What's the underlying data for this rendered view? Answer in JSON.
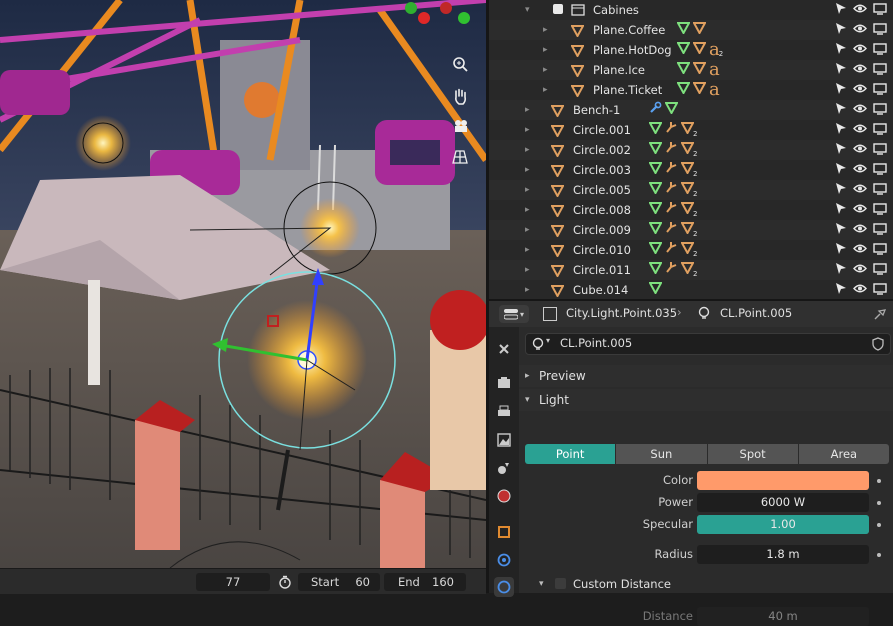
{
  "outliner": {
    "rows": [
      {
        "name": "Cabines",
        "indent": 2,
        "type": "collection",
        "checked": true,
        "mods": []
      },
      {
        "name": "Plane.Coffee",
        "indent": 3,
        "type": "mesh",
        "mods": [
          "mesh",
          "mat"
        ]
      },
      {
        "name": "Plane.HotDog",
        "indent": 3,
        "type": "mesh",
        "mods": [
          "mesh",
          "mat",
          "text2"
        ]
      },
      {
        "name": "Plane.Ice",
        "indent": 3,
        "type": "mesh",
        "mods": [
          "mesh",
          "mat",
          "text"
        ]
      },
      {
        "name": "Plane.Ticket",
        "indent": 3,
        "type": "mesh",
        "mods": [
          "mesh",
          "mat",
          "text"
        ]
      },
      {
        "name": "Bench-1",
        "indent": 2,
        "type": "mesh",
        "mods": [
          "wrench",
          "mesh"
        ]
      },
      {
        "name": "Circle.001",
        "indent": 2,
        "type": "mesh",
        "mods": [
          "mesh",
          "vgroup",
          "mat2"
        ]
      },
      {
        "name": "Circle.002",
        "indent": 2,
        "type": "mesh",
        "mods": [
          "mesh",
          "vgroup",
          "mat2"
        ]
      },
      {
        "name": "Circle.003",
        "indent": 2,
        "type": "mesh",
        "mods": [
          "mesh",
          "vgroup",
          "mat2"
        ]
      },
      {
        "name": "Circle.005",
        "indent": 2,
        "type": "mesh",
        "mods": [
          "mesh",
          "vgroup",
          "mat2"
        ]
      },
      {
        "name": "Circle.008",
        "indent": 2,
        "type": "mesh",
        "mods": [
          "mesh",
          "vgroup",
          "mat2"
        ]
      },
      {
        "name": "Circle.009",
        "indent": 2,
        "type": "mesh",
        "mods": [
          "mesh",
          "vgroup",
          "mat2"
        ]
      },
      {
        "name": "Circle.010",
        "indent": 2,
        "type": "mesh",
        "mods": [
          "mesh",
          "vgroup",
          "mat2"
        ]
      },
      {
        "name": "Circle.011",
        "indent": 2,
        "type": "mesh",
        "mods": [
          "mesh",
          "vgroup",
          "mat2"
        ]
      },
      {
        "name": "Cube.014",
        "indent": 2,
        "type": "mesh",
        "mods": [
          "mesh"
        ]
      }
    ],
    "badge_count": "2",
    "text_glyph": "a"
  },
  "props": {
    "breadcrumb_object": "City.Light.Point.035",
    "breadcrumb_data": "CL.Point.005",
    "datablock_name": "CL.Point.005",
    "sections": {
      "preview": "Preview",
      "light": "Light",
      "custom_distance": "Custom Distance"
    },
    "light_types": [
      "Point",
      "Sun",
      "Spot",
      "Area"
    ],
    "active_light_type": "Point",
    "fields": {
      "color_label": "Color",
      "color_value": "#ff9a6a",
      "power_label": "Power",
      "power_value": "6000 W",
      "specular_label": "Specular",
      "specular_value": "1.00",
      "specular_fraction": 1.0,
      "radius_label": "Radius",
      "radius_value": "1.8 m",
      "distance_label": "Distance",
      "distance_value": "40 m"
    }
  },
  "timeline": {
    "current_frame": "77",
    "start_label": "Start",
    "start_value": "60",
    "end_label": "End",
    "end_value": "160"
  },
  "colors": {
    "accent": "#2aa193",
    "mesh_icon": "#e0a060",
    "modifier_green": "#7ee07e",
    "light_yellow": "#ffd34d"
  }
}
